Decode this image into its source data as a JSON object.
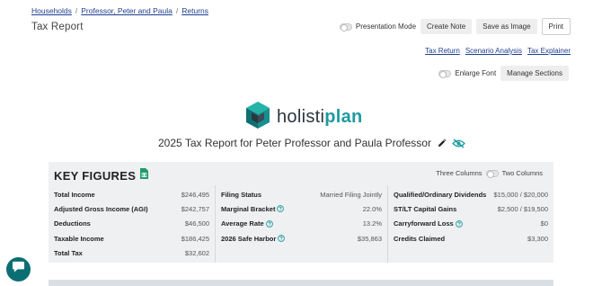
{
  "breadcrumb": {
    "items": [
      "Households",
      "Professor, Peter and Paula",
      "Returns"
    ],
    "separator": "/"
  },
  "page_title": "Tax Report",
  "top_actions": {
    "presentation_mode": "Presentation Mode",
    "create_note": "Create Note",
    "save_as_image": "Save as Image",
    "print": "Print"
  },
  "tab_links": [
    "Tax Return",
    "Scenario Analysis",
    "Tax Explainer"
  ],
  "row_actions": {
    "enlarge_font": "Enlarge Font",
    "manage_sections": "Manage Sections"
  },
  "logo": {
    "part1": "holisti",
    "part2": "plan"
  },
  "report": {
    "title": "2025 Tax Report for Peter Professor and Paula Professor"
  },
  "key_figures": {
    "title": "KEY FIGURES",
    "layout_toggle": {
      "left": "Three Columns",
      "right": "Two Columns"
    },
    "columns": [
      [
        {
          "label": "Total Income",
          "value": "$246,495"
        },
        {
          "label": "Adjusted Gross Income (AGI)",
          "value": "$242,757"
        },
        {
          "label": "Deductions",
          "value": "$46,500"
        },
        {
          "label": "Taxable Income",
          "value": "$186,425"
        },
        {
          "label": "Total Tax",
          "value": "$32,602"
        }
      ],
      [
        {
          "label": "Filing Status",
          "value": "Married Filing Jointly"
        },
        {
          "label": "Marginal Bracket",
          "value": "22.0%"
        },
        {
          "label": "Average Rate",
          "value": "13.2%"
        },
        {
          "label": "2026 Safe Harbor",
          "value": "$35,863"
        }
      ],
      [
        {
          "label": "Qualified/Ordinary Dividends",
          "value": "$15,000 / $20,000"
        },
        {
          "label": "ST/LT Capital Gains",
          "value": "$2,500 / $19,500"
        },
        {
          "label": "Carryforward Loss",
          "value": "$0"
        },
        {
          "label": "Credits Claimed",
          "value": "$3,300"
        }
      ]
    ]
  },
  "colors": {
    "link": "#1f3f8f",
    "brand_teal": "#1e9aa0",
    "brand_dark": "#2b3640",
    "panel_bg": "#eef0f1",
    "chat_bubble": "#0b6e72"
  },
  "icons": [
    "help-icon",
    "pencil-icon",
    "eye-slash-icon",
    "spreadsheet-icon",
    "chat-icon",
    "logo-cube-icon"
  ]
}
